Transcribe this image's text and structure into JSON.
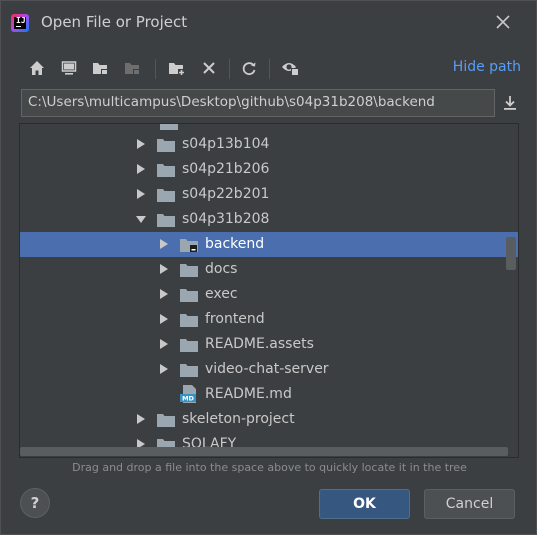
{
  "window": {
    "title": "Open File or Project",
    "logo_text": "IJ"
  },
  "toolbar": {
    "hide_path_label": "Hide path"
  },
  "path": {
    "value": "C:\\Users\\multicampus\\Desktop\\github\\s04p31b208\\backend"
  },
  "tree": {
    "rows": [
      {
        "label": "s04p13b104",
        "depth": 0,
        "expanded": false,
        "type": "folder"
      },
      {
        "label": "s04p21b206",
        "depth": 0,
        "expanded": false,
        "type": "folder"
      },
      {
        "label": "s04p22b201",
        "depth": 0,
        "expanded": false,
        "type": "folder"
      },
      {
        "label": "s04p31b208",
        "depth": 0,
        "expanded": true,
        "type": "folder"
      },
      {
        "label": "backend",
        "depth": 1,
        "expanded": false,
        "type": "module-folder",
        "selected": true
      },
      {
        "label": "docs",
        "depth": 1,
        "expanded": false,
        "type": "folder"
      },
      {
        "label": "exec",
        "depth": 1,
        "expanded": false,
        "type": "folder"
      },
      {
        "label": "frontend",
        "depth": 1,
        "expanded": false,
        "type": "folder"
      },
      {
        "label": "README.assets",
        "depth": 1,
        "expanded": false,
        "type": "folder"
      },
      {
        "label": "video-chat-server",
        "depth": 1,
        "expanded": false,
        "type": "folder"
      },
      {
        "label": "README.md",
        "depth": 1,
        "type": "markdown-file",
        "file_badge": "MD"
      },
      {
        "label": "skeleton-project",
        "depth": 0,
        "expanded": false,
        "type": "folder"
      },
      {
        "label": "SOLAFY",
        "depth": 0,
        "expanded": false,
        "type": "folder"
      }
    ]
  },
  "hint": "Drag and drop a file into the space above to quickly locate it in the tree",
  "footer": {
    "help_label": "?",
    "ok_label": "OK",
    "cancel_label": "Cancel"
  },
  "colors": {
    "background": "#3c3f41",
    "selection": "#4b6eaf",
    "link": "#589df6",
    "primary_button": "#365880",
    "folder": "#9aa7b0"
  }
}
